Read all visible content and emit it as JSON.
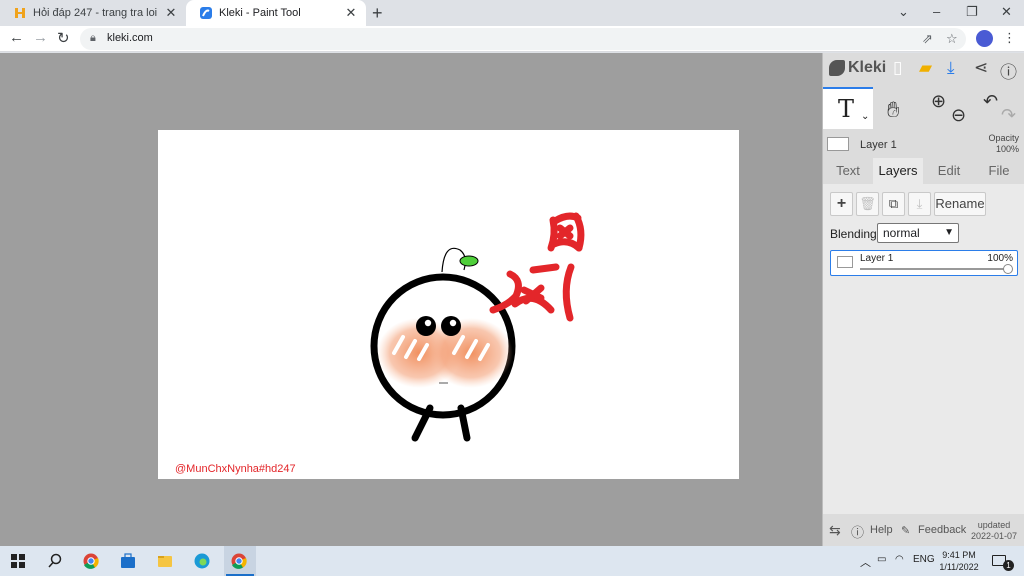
{
  "browser": {
    "tabs": [
      {
        "title": "Hỏi đáp 247 - trang tra loi",
        "active": false
      },
      {
        "title": "Kleki - Paint Tool",
        "active": true
      }
    ],
    "close_glyph": "✕",
    "new_tab_glyph": "+",
    "url": "kleki.com",
    "window_controls": {
      "dropdown": "⌄",
      "minimize": "–",
      "restore": "❐",
      "close": "✕"
    }
  },
  "canvas": {
    "watermark": "@MunChxNynha#hd247",
    "colors": {
      "background": "#ffffff",
      "stroke": "#000000",
      "anger": "#e3262a",
      "blush": "#f4a27a",
      "sprout": "#4fcf3a"
    }
  },
  "kleki": {
    "brand": "Kleki",
    "layer_name": "Layer 1",
    "opacity_label": "Opacity",
    "opacity_value": "100%",
    "tabs": [
      "Text",
      "Layers",
      "Edit",
      "File"
    ],
    "active_tab": "Layers",
    "rename_label": "Rename",
    "blending_label": "Blending",
    "blending_value": "normal",
    "layer_card": {
      "name": "Layer 1",
      "opacity": "100%",
      "opacity_fraction": 1.0
    },
    "footer": {
      "help": "Help",
      "feedback": "Feedback",
      "updated_label": "updated",
      "updated_date": "2022-01-07"
    },
    "accent_color": "#2b7de9"
  },
  "taskbar": {
    "language": "ENG",
    "time": "9:41 PM",
    "date": "1/11/2022",
    "notification_count": "1"
  }
}
